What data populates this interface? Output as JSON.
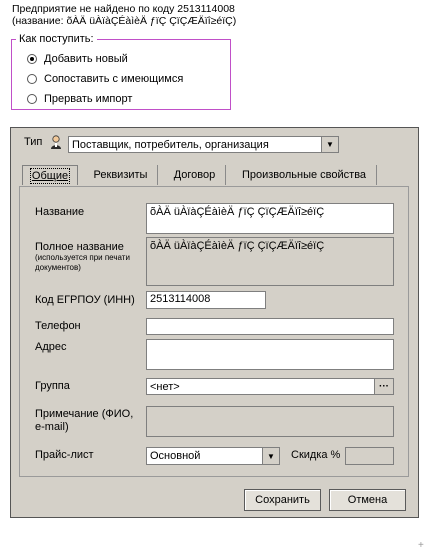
{
  "message": {
    "line1": "Предприятие не найдено по коду  2513114008",
    "line2": "(название: õÀÄ üÀïàÇÉàìèÄ ƒïÇ ÇïÇÆÄïî≥éïÇ)"
  },
  "how_group": {
    "legend": "Как поступить:",
    "options": [
      {
        "label": "Добавить новый",
        "checked": true
      },
      {
        "label": "Сопоставить с имеющимся",
        "checked": false
      },
      {
        "label": "Прервать импорт",
        "checked": false
      }
    ]
  },
  "dialog": {
    "type_label": "Тип",
    "type_value": "Поставщик, потребитель, организация",
    "tabs": [
      "Общие",
      "Реквизиты",
      "Договор",
      "Произвольные свойства"
    ],
    "active_tab": "Общие",
    "fields": {
      "name_label": "Название",
      "name_value": "õÀÄ üÀïàÇÉàìèÄ ƒïÇ ÇïÇÆÄïî≥éïÇ",
      "fullname_label": "Полное название",
      "fullname_hint": "(используется при печати документов)",
      "fullname_value": "õÀÄ üÀïàÇÉàìèÄ ƒïÇ ÇïÇÆÄïî≥éïÇ",
      "code_label": "Код ЕГРПОУ (ИНН)",
      "code_value": "2513114008",
      "phone_label": "Телефон",
      "phone_value": "",
      "address_label": "Адрес",
      "address_value": "",
      "group_label": "Группа",
      "group_value": "<нет>",
      "note_label": "Примечание (ФИО, e-mail)",
      "note_value": "",
      "pricelist_label": "Прайс-лист",
      "pricelist_value": "Основной",
      "discount_label": "Скидка %",
      "discount_value": ""
    },
    "buttons": {
      "save": "Сохранить",
      "cancel": "Отмена"
    }
  }
}
